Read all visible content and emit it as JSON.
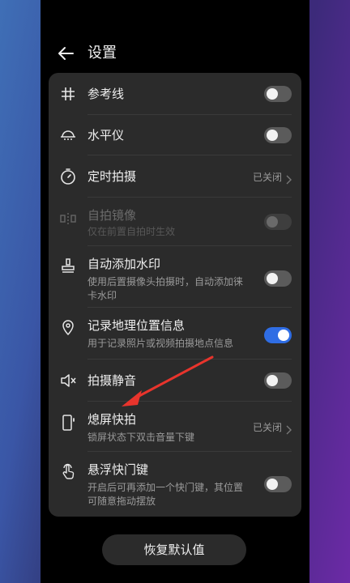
{
  "header": {
    "title": "设置"
  },
  "rows": [
    {
      "label": "参考线",
      "control": "toggle",
      "state": "off"
    },
    {
      "label": "水平仪",
      "control": "toggle",
      "state": "off"
    },
    {
      "label": "定时拍摄",
      "control": "value",
      "value": "已关闭"
    },
    {
      "label": "自拍镜像",
      "sub": "仅在前置自拍时生效",
      "control": "toggle",
      "state": "disabled"
    },
    {
      "label": "自动添加水印",
      "sub": "使用后置摄像头拍摄时，自动添加徕卡水印",
      "control": "toggle",
      "state": "off"
    },
    {
      "label": "记录地理位置信息",
      "sub": "用于记录照片或视频拍摄地点信息",
      "control": "toggle",
      "state": "on"
    },
    {
      "label": "拍摄静音",
      "control": "toggle",
      "state": "off"
    },
    {
      "label": "熄屏快拍",
      "sub": "锁屏状态下双击音量下键",
      "control": "value",
      "value": "已关闭"
    },
    {
      "label": "悬浮快门键",
      "sub": "开启后可再添加一个快门键，其位置可随意拖动摆放",
      "control": "toggle",
      "state": "off"
    }
  ],
  "footer": {
    "reset_label": "恢复默认值"
  },
  "colors": {
    "accent": "#2f6de4",
    "annotation_arrow": "#e8342c"
  }
}
